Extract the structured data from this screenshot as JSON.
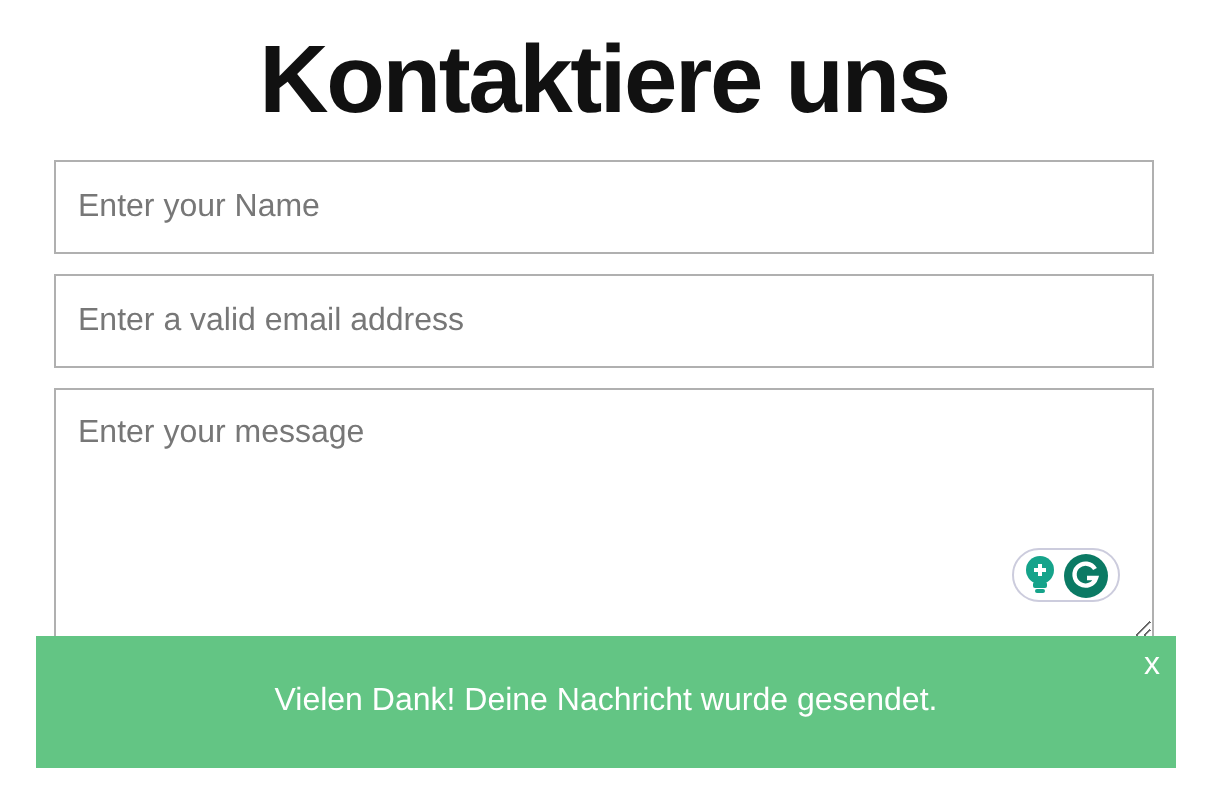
{
  "title": "Kontaktiere uns",
  "fields": [
    {
      "kind": "input",
      "placeholder": "Enter your Name"
    },
    {
      "kind": "input",
      "placeholder": "Enter a valid email address"
    },
    {
      "kind": "textarea",
      "placeholder": "Enter your message"
    }
  ],
  "toast": {
    "message": "Vielen Dank! Deine Nachricht wurde gesendet.",
    "close": "x"
  }
}
